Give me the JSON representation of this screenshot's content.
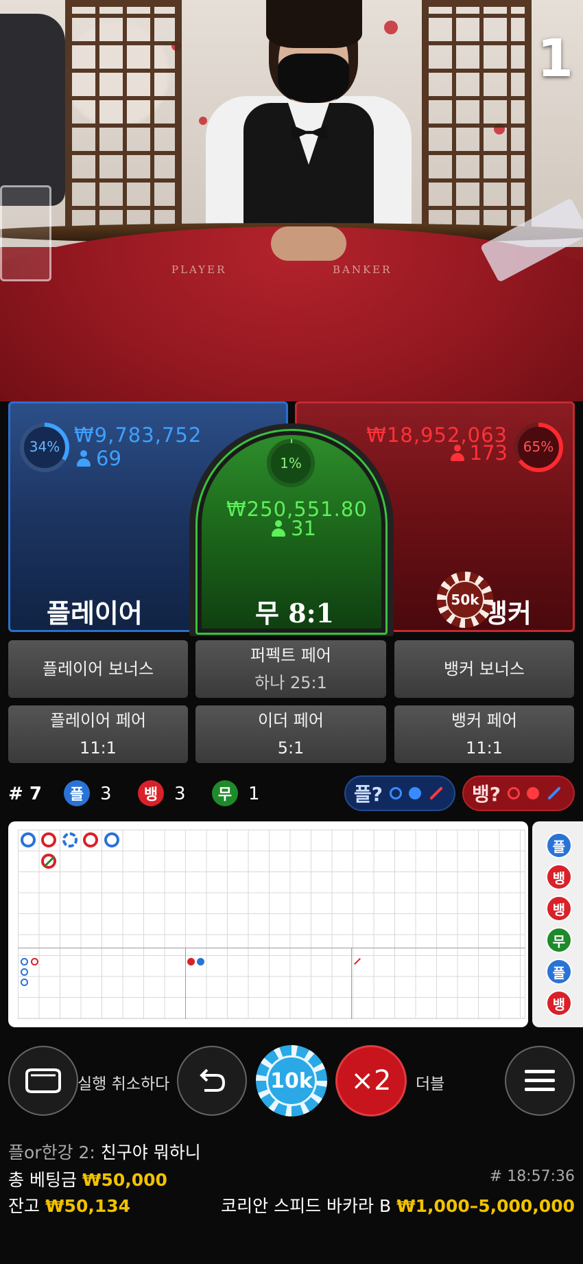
{
  "round_number": "1",
  "felt": {
    "player_text": "PLAYER",
    "banker_text": "BANKER"
  },
  "bets": {
    "player": {
      "label": "플레이어",
      "amount": "₩9,783,752",
      "bettors": "69",
      "percent": "34%",
      "percent_value": 0.34,
      "color": "#2b6fcf"
    },
    "tie": {
      "label": "무 8:1",
      "amount": "₩250,551.80",
      "bettors": "31",
      "percent": "1%",
      "percent_value": 0.01,
      "color": "#39c23f"
    },
    "banker": {
      "label": "뱅커",
      "amount": "₩18,952,063",
      "bettors": "173",
      "percent": "65%",
      "percent_value": 0.65,
      "color": "#e0262d"
    },
    "placed_chip": "50k"
  },
  "side_bets": [
    {
      "title": "플레이어 보너스",
      "sub": ""
    },
    {
      "title": "퍼펙트 페어",
      "sub": "하나 25:1"
    },
    {
      "title": "뱅커 보너스",
      "sub": ""
    },
    {
      "title": "플레이어 페어",
      "sub": "11:1"
    },
    {
      "title": "이더 페어",
      "sub": "5:1"
    },
    {
      "title": "뱅커 페어",
      "sub": "11:1"
    }
  ],
  "stats": {
    "round_label": "# 7",
    "player_badge": "플",
    "player_count": "3",
    "banker_badge": "뱅",
    "banker_count": "3",
    "tie_badge": "무",
    "tie_count": "1",
    "player_predict": "플?",
    "banker_predict": "뱅?"
  },
  "side_road": [
    "플",
    "뱅",
    "뱅",
    "무",
    "플",
    "뱅"
  ],
  "controls": {
    "undo_label": "실행 취소하다",
    "chip_value": "10k",
    "double_symbol": "×2",
    "double_label": "더블"
  },
  "footer": {
    "chat_user": "플or한강 2:",
    "chat_message": " 친구야 뭐하니",
    "total_bet_label": "총 베팅금",
    "total_bet_value": "₩50,000",
    "time": "# 18:57:36",
    "balance_label": "잔고",
    "balance_value": "₩50,134",
    "table_name": "코리안 스피드 바카라 B",
    "limits": "₩1,000–5,000,000"
  },
  "colors": {
    "player_blue": "#2b6fcf",
    "banker_red": "#e0262d",
    "tie_green": "#39c23f",
    "gold": "#f2c200"
  }
}
